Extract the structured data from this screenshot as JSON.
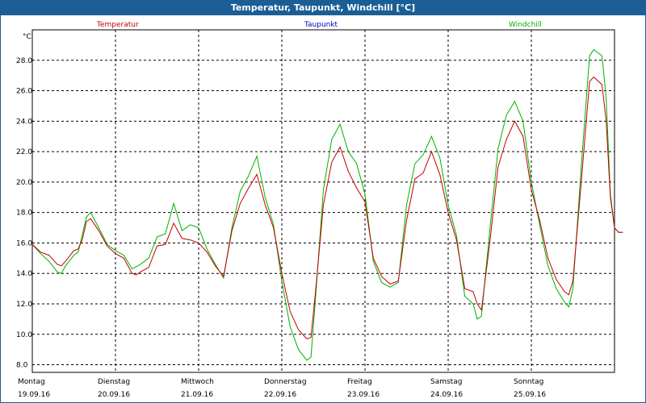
{
  "window": {
    "title": "Temperatur, Taupunkt, Windchill [°C]"
  },
  "chart_data": {
    "type": "line",
    "title": "Temperatur, Taupunkt, Windchill [°C]",
    "ylabel": "°C",
    "xlabel": "",
    "ylim": [
      7.5,
      30.0
    ],
    "yticks": [
      8.0,
      10.0,
      12.0,
      14.0,
      16.0,
      18.0,
      20.0,
      22.0,
      24.0,
      26.0,
      28.0
    ],
    "grid": true,
    "legend_position": "top",
    "days": [
      {
        "weekday": "Montag",
        "date": "19.09.16"
      },
      {
        "weekday": "Dienstag",
        "date": "20.09.16"
      },
      {
        "weekday": "Mittwoch",
        "date": "21.09.16"
      },
      {
        "weekday": "Donnerstag",
        "date": "22.09.16"
      },
      {
        "weekday": "Freitag",
        "date": "23.09.16"
      },
      {
        "weekday": "Samstag",
        "date": "24.09.16"
      },
      {
        "weekday": "Sonntag",
        "date": "25.09.16"
      }
    ],
    "x_unit": "days since 19.09.16 00:00",
    "x_range": [
      0,
      7.0
    ],
    "series": [
      {
        "name": "Temperatur",
        "color": "#c00000",
        "points": [
          [
            0.0,
            15.9
          ],
          [
            0.1,
            15.4
          ],
          [
            0.2,
            15.2
          ],
          [
            0.3,
            14.6
          ],
          [
            0.35,
            14.5
          ],
          [
            0.4,
            14.8
          ],
          [
            0.5,
            15.5
          ],
          [
            0.55,
            15.6
          ],
          [
            0.6,
            16.2
          ],
          [
            0.65,
            17.4
          ],
          [
            0.7,
            17.6
          ],
          [
            0.8,
            16.8
          ],
          [
            0.9,
            15.8
          ],
          [
            1.0,
            15.3
          ],
          [
            1.1,
            15.0
          ],
          [
            1.2,
            14.0
          ],
          [
            1.25,
            13.9
          ],
          [
            1.3,
            14.1
          ],
          [
            1.4,
            14.4
          ],
          [
            1.5,
            15.8
          ],
          [
            1.6,
            15.9
          ],
          [
            1.7,
            17.3
          ],
          [
            1.8,
            16.3
          ],
          [
            1.9,
            16.2
          ],
          [
            2.0,
            16.0
          ],
          [
            2.1,
            15.4
          ],
          [
            2.2,
            14.5
          ],
          [
            2.3,
            13.8
          ],
          [
            2.4,
            16.8
          ],
          [
            2.5,
            18.6
          ],
          [
            2.6,
            19.6
          ],
          [
            2.7,
            20.5
          ],
          [
            2.8,
            18.5
          ],
          [
            2.9,
            17.0
          ],
          [
            3.0,
            14.0
          ],
          [
            3.1,
            11.5
          ],
          [
            3.2,
            10.3
          ],
          [
            3.3,
            9.7
          ],
          [
            3.35,
            9.8
          ],
          [
            3.4,
            12.5
          ],
          [
            3.5,
            18.5
          ],
          [
            3.6,
            21.3
          ],
          [
            3.7,
            22.3
          ],
          [
            3.8,
            20.7
          ],
          [
            3.9,
            19.6
          ],
          [
            4.0,
            18.7
          ],
          [
            4.1,
            15.0
          ],
          [
            4.2,
            13.8
          ],
          [
            4.3,
            13.3
          ],
          [
            4.4,
            13.5
          ],
          [
            4.5,
            17.5
          ],
          [
            4.6,
            20.2
          ],
          [
            4.7,
            20.6
          ],
          [
            4.8,
            22.0
          ],
          [
            4.9,
            20.5
          ],
          [
            5.0,
            18.0
          ],
          [
            5.1,
            16.2
          ],
          [
            5.2,
            13.0
          ],
          [
            5.3,
            12.8
          ],
          [
            5.35,
            12.0
          ],
          [
            5.4,
            11.6
          ],
          [
            5.5,
            16.0
          ],
          [
            5.6,
            21.0
          ],
          [
            5.7,
            22.8
          ],
          [
            5.8,
            24.0
          ],
          [
            5.9,
            23.0
          ],
          [
            6.0,
            19.5
          ],
          [
            6.1,
            17.5
          ],
          [
            6.2,
            15.0
          ],
          [
            6.3,
            13.6
          ],
          [
            6.4,
            12.8
          ],
          [
            6.45,
            12.6
          ],
          [
            6.5,
            13.5
          ],
          [
            6.6,
            20.0
          ],
          [
            6.7,
            26.6
          ],
          [
            6.75,
            26.9
          ],
          [
            6.85,
            26.4
          ],
          [
            6.9,
            24.0
          ],
          [
            6.95,
            19.0
          ],
          [
            7.0,
            17.0
          ],
          [
            7.05,
            16.7
          ],
          [
            7.1,
            16.7
          ]
        ]
      },
      {
        "name": "Taupunkt",
        "color": "#0000c0",
        "points": []
      },
      {
        "name": "Windchill",
        "color": "#00b000",
        "points": [
          [
            0.0,
            15.9
          ],
          [
            0.1,
            15.3
          ],
          [
            0.2,
            14.8
          ],
          [
            0.3,
            14.1
          ],
          [
            0.35,
            14.0
          ],
          [
            0.4,
            14.5
          ],
          [
            0.5,
            15.2
          ],
          [
            0.55,
            15.4
          ],
          [
            0.6,
            16.5
          ],
          [
            0.65,
            17.7
          ],
          [
            0.7,
            18.0
          ],
          [
            0.8,
            17.0
          ],
          [
            0.9,
            15.9
          ],
          [
            1.0,
            15.5
          ],
          [
            1.1,
            15.2
          ],
          [
            1.2,
            14.3
          ],
          [
            1.3,
            14.6
          ],
          [
            1.4,
            15.0
          ],
          [
            1.5,
            16.4
          ],
          [
            1.6,
            16.6
          ],
          [
            1.7,
            18.6
          ],
          [
            1.8,
            16.8
          ],
          [
            1.9,
            17.2
          ],
          [
            2.0,
            17.0
          ],
          [
            2.1,
            15.6
          ],
          [
            2.2,
            14.6
          ],
          [
            2.3,
            13.7
          ],
          [
            2.4,
            17.0
          ],
          [
            2.5,
            19.4
          ],
          [
            2.6,
            20.4
          ],
          [
            2.7,
            21.7
          ],
          [
            2.8,
            19.0
          ],
          [
            2.9,
            17.2
          ],
          [
            3.0,
            13.5
          ],
          [
            3.1,
            10.5
          ],
          [
            3.2,
            9.0
          ],
          [
            3.3,
            8.3
          ],
          [
            3.35,
            8.5
          ],
          [
            3.4,
            12.0
          ],
          [
            3.5,
            19.5
          ],
          [
            3.6,
            22.8
          ],
          [
            3.7,
            23.8
          ],
          [
            3.8,
            22.0
          ],
          [
            3.9,
            21.2
          ],
          [
            4.0,
            19.2
          ],
          [
            4.1,
            14.8
          ],
          [
            4.2,
            13.4
          ],
          [
            4.3,
            13.1
          ],
          [
            4.4,
            13.4
          ],
          [
            4.5,
            18.5
          ],
          [
            4.6,
            21.2
          ],
          [
            4.7,
            21.8
          ],
          [
            4.8,
            23.0
          ],
          [
            4.9,
            21.6
          ],
          [
            5.0,
            18.5
          ],
          [
            5.1,
            16.5
          ],
          [
            5.2,
            12.5
          ],
          [
            5.3,
            12.0
          ],
          [
            5.35,
            11.0
          ],
          [
            5.4,
            11.2
          ],
          [
            5.5,
            16.8
          ],
          [
            5.6,
            22.2
          ],
          [
            5.7,
            24.4
          ],
          [
            5.8,
            25.3
          ],
          [
            5.9,
            24.0
          ],
          [
            6.0,
            20.0
          ],
          [
            6.1,
            17.2
          ],
          [
            6.2,
            14.5
          ],
          [
            6.3,
            13.0
          ],
          [
            6.4,
            12.1
          ],
          [
            6.45,
            11.8
          ],
          [
            6.5,
            13.0
          ],
          [
            6.6,
            21.0
          ],
          [
            6.7,
            28.3
          ],
          [
            6.75,
            28.7
          ],
          [
            6.85,
            28.3
          ],
          [
            6.9,
            25.5
          ],
          [
            6.95,
            19.2
          ],
          [
            7.0,
            17.0
          ],
          [
            7.05,
            16.7
          ],
          [
            7.1,
            16.7
          ]
        ]
      }
    ]
  }
}
